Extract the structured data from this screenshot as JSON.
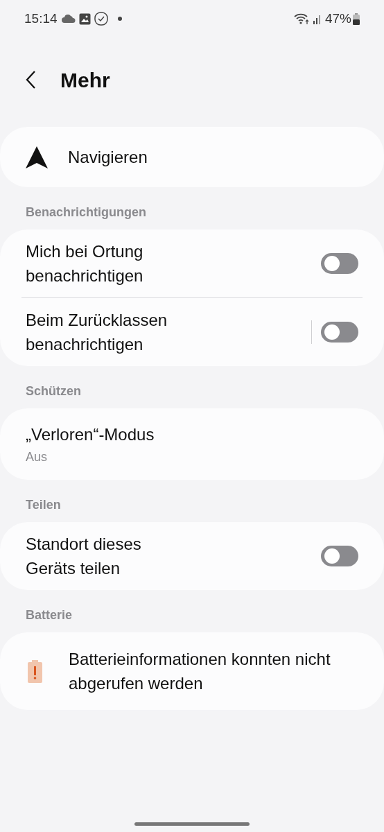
{
  "status_bar": {
    "time": "15:14",
    "battery": "47%"
  },
  "header": {
    "title": "Mehr"
  },
  "navigate": {
    "label": "Navigieren"
  },
  "sections": [
    {
      "title": "Benachrichtigungen",
      "items": [
        {
          "kind": "toggle",
          "label": "Mich bei Ortung benachrichtigen",
          "on": false
        },
        {
          "kind": "toggle",
          "label": "Beim Zurücklassen benachrichtigen",
          "on": false
        }
      ]
    },
    {
      "title": "Schützen",
      "items": [
        {
          "kind": "link",
          "label": "„Verloren“-Modus",
          "subtitle": "Aus"
        }
      ]
    },
    {
      "title": "Teilen",
      "items": [
        {
          "kind": "toggle",
          "label": "Standort dieses Geräts teilen",
          "on": false
        }
      ]
    },
    {
      "title": "Batterie",
      "items": [
        {
          "kind": "warning",
          "label": "Batterieinformationen konnten nicht abgerufen werden"
        }
      ]
    }
  ]
}
